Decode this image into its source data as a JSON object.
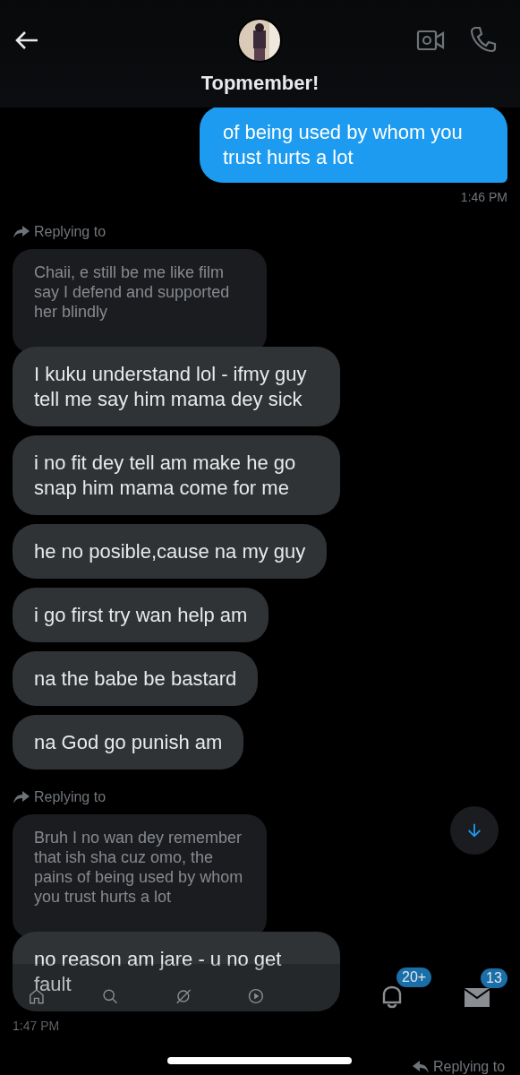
{
  "header": {
    "title": "Topmember!"
  },
  "messages": [
    {
      "kind": "sent",
      "text": "of being used by whom you trust hurts a lot"
    },
    {
      "kind": "time",
      "text": "1:46 PM"
    },
    {
      "kind": "reply-label",
      "text": "Replying to"
    },
    {
      "kind": "quote",
      "text": "Chaii, e still be me like film say I defend and supported her blindly"
    },
    {
      "kind": "received",
      "text": "I kuku understand lol - ifmy guy tell me say him mama dey sick"
    },
    {
      "kind": "received",
      "text": "i no fit dey tell am make he go snap him mama come for me"
    },
    {
      "kind": "received",
      "text": "he no posible,cause na my guy"
    },
    {
      "kind": "received",
      "text": "i go first try wan help am"
    },
    {
      "kind": "received",
      "text": "na the babe be bastard"
    },
    {
      "kind": "received",
      "text": "na God go punish am"
    },
    {
      "kind": "reply-label",
      "text": "Replying to"
    },
    {
      "kind": "quote",
      "text": "Bruh I no wan dey remember that ish sha cuz omo, the pains of being used by whom you trust hurts a lot"
    },
    {
      "kind": "received",
      "text": "no reason am jare - u no get fault"
    },
    {
      "kind": "time",
      "text": "1:47 PM"
    }
  ],
  "tab_bar": {
    "notifications_badge": "20+",
    "messages_badge": "13"
  },
  "bottom_reply_label": "Replying to"
}
